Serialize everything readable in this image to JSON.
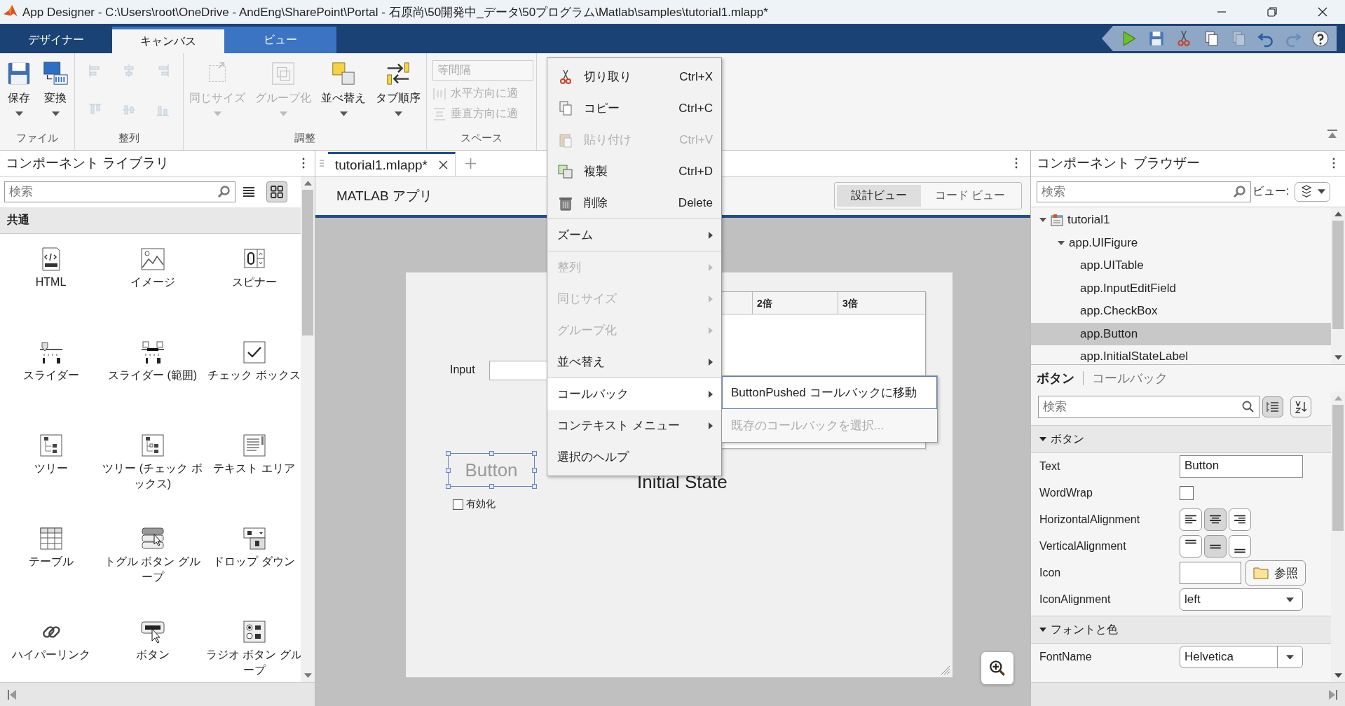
{
  "window": {
    "title": "App Designer - C:\\Users\\root\\OneDrive - AndEng\\SharePoint\\Portal - 石原尚\\50開発中_データ\\50プログラム\\Matlab\\samples\\tutorial1.mlapp*"
  },
  "ribbon_tabs": [
    {
      "label": "デザイナー",
      "selected": false,
      "contextual": false
    },
    {
      "label": "キャンバス",
      "selected": true,
      "contextual": true
    },
    {
      "label": "ビュー",
      "selected": false,
      "contextual": true
    }
  ],
  "quick_access": [
    {
      "kind": "run",
      "disabled": false
    },
    {
      "kind": "save",
      "disabled": false
    },
    {
      "kind": "cut",
      "disabled": false
    },
    {
      "kind": "copy",
      "disabled": false
    },
    {
      "kind": "paste",
      "disabled": true
    },
    {
      "kind": "undo",
      "disabled": false
    },
    {
      "kind": "redo",
      "disabled": true
    },
    {
      "kind": "help",
      "disabled": false
    }
  ],
  "ribbon_groups": [
    {
      "label": "ファイル",
      "items": [
        {
          "kind": "save",
          "label": "保存",
          "menu": true,
          "disabled": false
        },
        {
          "kind": "convert",
          "label": "変換",
          "menu": true,
          "disabled": false
        }
      ]
    },
    {
      "label": "整列",
      "small": [
        {
          "kind": "left",
          "disabled": true
        },
        {
          "kind": "hcenter",
          "disabled": true
        },
        {
          "kind": "right",
          "disabled": true
        },
        {
          "kind": "top",
          "disabled": true
        },
        {
          "kind": "vcenter",
          "disabled": true
        },
        {
          "kind": "bottom",
          "disabled": true
        }
      ]
    },
    {
      "label": "調整",
      "items": [
        {
          "kind": "samesize",
          "label": "同じサイズ",
          "menu": true,
          "disabled": true
        },
        {
          "kind": "group",
          "label": "グループ化",
          "menu": true,
          "disabled": true
        },
        {
          "kind": "arrange",
          "label": "並べ替え",
          "menu": true,
          "disabled": false
        },
        {
          "kind": "taborder",
          "label": "タブ順序",
          "menu": true,
          "disabled": false
        }
      ]
    },
    {
      "label": "スペース",
      "dropdown": {
        "value": "等間隔",
        "disabled": true
      },
      "buttons": [
        {
          "kind": "horizontal",
          "label": "水平方向に適",
          "disabled": true
        },
        {
          "kind": "vertical",
          "label": "垂直方向に適",
          "disabled": true
        }
      ]
    }
  ],
  "library": {
    "title": "コンポーネント ライブラリ",
    "search": {
      "placeholder": "検索"
    },
    "views": [
      {
        "kind": "list",
        "selected": false
      },
      {
        "kind": "grid",
        "selected": true
      }
    ],
    "section": "共通",
    "items": [
      {
        "kind": "html",
        "label": "HTML"
      },
      {
        "kind": "image",
        "label": "イメージ"
      },
      {
        "kind": "spinner",
        "label": "スピナー"
      },
      {
        "kind": "slider",
        "label": "スライダー"
      },
      {
        "kind": "rangeslider",
        "label": "スライダー (範囲)"
      },
      {
        "kind": "checkbox",
        "label": "チェック ボックス"
      },
      {
        "kind": "tree",
        "label": "ツリー"
      },
      {
        "kind": "checktree",
        "label": "ツリー (チェック ボックス)"
      },
      {
        "kind": "textarea",
        "label": "テキスト エリア"
      },
      {
        "kind": "table",
        "label": "テーブル"
      },
      {
        "kind": "togglegroup",
        "label": "トグル ボタン グループ"
      },
      {
        "kind": "dropdown",
        "label": "ドロップ ダウン"
      },
      {
        "kind": "hyperlink",
        "label": "ハイパーリンク"
      },
      {
        "kind": "button",
        "label": "ボタン"
      },
      {
        "kind": "radiogroup",
        "label": "ラジオ ボタン グループ"
      }
    ]
  },
  "editor": {
    "tabs": [
      {
        "label": "tutorial1.mlapp*",
        "selected": true
      }
    ],
    "title": "MATLAB アプリ",
    "views": [
      {
        "label": "設計ビュー",
        "selected": true
      },
      {
        "label": "コード ビュー",
        "selected": false
      }
    ],
    "canvas": {
      "input_label": "Input",
      "table_columns": [
        "2倍",
        "3倍"
      ],
      "button": {
        "text": "Button",
        "disabled": true,
        "selected": true
      },
      "checkbox": {
        "label": "有効化",
        "checked": false
      },
      "label": "Initial State"
    }
  },
  "context_menu": {
    "items": [
      {
        "kind": "cut",
        "label": "切り取り",
        "shortcut": "Ctrl+X",
        "disabled": false
      },
      {
        "kind": "copy",
        "label": "コピー",
        "shortcut": "Ctrl+C",
        "disabled": false
      },
      {
        "kind": "paste",
        "label": "貼り付け",
        "shortcut": "Ctrl+V",
        "disabled": true
      },
      {
        "kind": "duplicate",
        "label": "複製",
        "shortcut": "Ctrl+D",
        "disabled": false
      },
      {
        "kind": "delete",
        "label": "削除",
        "shortcut": "Delete",
        "disabled": false
      },
      {
        "kind": "separator"
      },
      {
        "kind": "submenu",
        "label": "ズーム",
        "disabled": false,
        "selected": false
      },
      {
        "kind": "separator"
      },
      {
        "kind": "submenu",
        "label": "整列",
        "disabled": true,
        "selected": false
      },
      {
        "kind": "submenu",
        "label": "同じサイズ",
        "disabled": true,
        "selected": false
      },
      {
        "kind": "submenu",
        "label": "グループ化",
        "disabled": true,
        "selected": false
      },
      {
        "kind": "submenu",
        "label": "並べ替え",
        "disabled": false,
        "selected": false
      },
      {
        "kind": "separator"
      },
      {
        "kind": "submenu",
        "label": "コールバック",
        "disabled": false,
        "selected": true
      },
      {
        "kind": "submenu",
        "label": "コンテキスト メニュー",
        "disabled": false,
        "selected": false
      },
      {
        "kind": "plain",
        "label": "選択のヘルプ",
        "disabled": false,
        "selected": false
      }
    ],
    "submenu": [
      {
        "label": "ButtonPushed コールバックに移動",
        "disabled": false,
        "selected": true
      },
      {
        "label": "既存のコールバックを選択...",
        "disabled": true,
        "selected": false
      }
    ]
  },
  "browser": {
    "title": "コンポーネント ブラウザー",
    "search": {
      "placeholder": "検索"
    },
    "view_label": "ビュー:",
    "tree": [
      {
        "label": "tutorial1",
        "expanded": true,
        "selected": false,
        "children": [
          {
            "label": "app.UIFigure",
            "expanded": true,
            "selected": false,
            "children": [
              {
                "label": "app.UITable",
                "selected": false
              },
              {
                "label": "app.InputEditField",
                "selected": false
              },
              {
                "label": "app.CheckBox",
                "selected": false
              },
              {
                "label": "app.Button",
                "selected": true
              },
              {
                "label": "app.InitialStateLabel",
                "selected": false
              }
            ]
          }
        ]
      }
    ]
  },
  "inspector": {
    "tabs": [
      {
        "label": "ボタン",
        "selected": true
      },
      {
        "label": "コールバック",
        "selected": false
      }
    ],
    "search": {
      "placeholder": "検索"
    },
    "tools": [
      {
        "kind": "grouped",
        "selected": true
      },
      {
        "kind": "sorted",
        "selected": false
      }
    ],
    "sections": [
      {
        "title": "ボタン",
        "expanded": true,
        "rows": [
          {
            "kind": "text",
            "label": "Text",
            "value": "Button"
          },
          {
            "kind": "checkbox",
            "label": "WordWrap",
            "checked": false
          },
          {
            "kind": "halign",
            "label": "HorizontalAlignment",
            "options": [
              {
                "kind": "left",
                "selected": false
              },
              {
                "kind": "center",
                "selected": true
              },
              {
                "kind": "right",
                "selected": false
              }
            ]
          },
          {
            "kind": "valign",
            "label": "VerticalAlignment",
            "options": [
              {
                "kind": "top",
                "selected": false
              },
              {
                "kind": "middle",
                "selected": true
              },
              {
                "kind": "bottom",
                "selected": false
              }
            ]
          },
          {
            "kind": "file",
            "label": "Icon",
            "button": "参照"
          },
          {
            "kind": "select",
            "label": "IconAlignment",
            "value": "left"
          }
        ]
      },
      {
        "title": "フォントと色",
        "expanded": true,
        "rows": [
          {
            "kind": "combo",
            "label": "FontName",
            "value": "Helvetica"
          }
        ]
      }
    ]
  }
}
